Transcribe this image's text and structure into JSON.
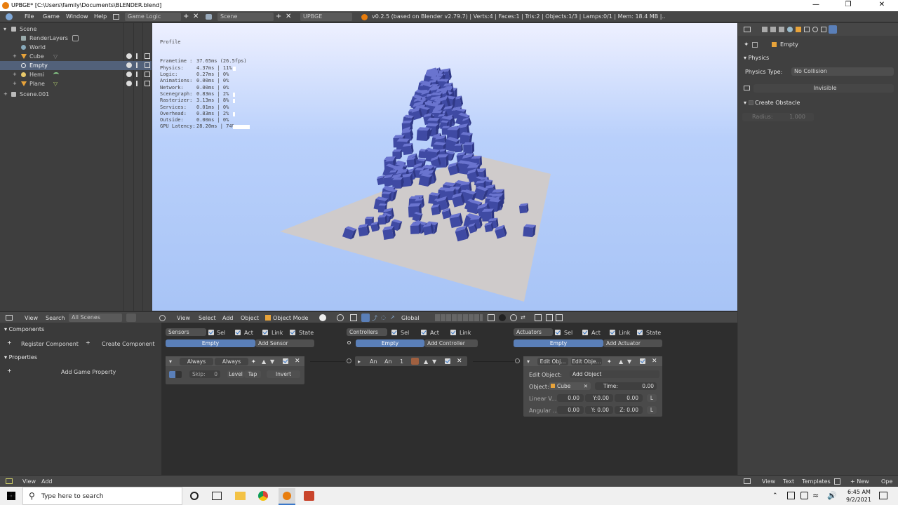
{
  "window": {
    "title": "UPBGE* [C:\\Users\\family\\Documents\\BLENDER.blend]"
  },
  "header": {
    "menus": [
      "File",
      "Game",
      "Window",
      "Help"
    ],
    "screen_layout": "Game Logic",
    "scene_name": "Scene",
    "engine": "UPBGE",
    "info": "v0.2.5 (based on Blender v2.79.7) | Verts:4 | Faces:1 | Tris:2 | Objects:1/3 | Lamps:0/1 | Mem: 18.4 MB |.."
  },
  "outliner": {
    "items": [
      {
        "label": "Scene",
        "icon": "scene-icon"
      },
      {
        "label": "RenderLayers",
        "icon": "renderlayers-icon"
      },
      {
        "label": "World",
        "icon": "world-icon"
      },
      {
        "label": "Cube",
        "icon": "mesh-icon"
      },
      {
        "label": "Empty",
        "icon": "empty-icon"
      },
      {
        "label": "Hemi",
        "icon": "lamp-icon"
      },
      {
        "label": "Plane",
        "icon": "mesh-icon"
      },
      {
        "label": "Scene.001",
        "icon": "scene-icon"
      }
    ]
  },
  "profile": {
    "title": "Profile",
    "rows": [
      {
        "name": "Frametime :",
        "value": "37.65ms (26.5fps)",
        "fill": 0
      },
      {
        "name": "Physics:",
        "value": "4.37ms | 11%",
        "fill": 0.11
      },
      {
        "name": "Logic:",
        "value": "0.27ms | 0%",
        "fill": 0
      },
      {
        "name": "Animations:",
        "value": "0.00ms | 0%",
        "fill": 0
      },
      {
        "name": "Network:",
        "value": "0.00ms | 0%",
        "fill": 0
      },
      {
        "name": "Scenegraph:",
        "value": "0.83ms | 2%",
        "fill": 0.02
      },
      {
        "name": "Rasterizer:",
        "value": "3.13ms | 8%",
        "fill": 0.08
      },
      {
        "name": "Services:",
        "value": "0.01ms | 0%",
        "fill": 0
      },
      {
        "name": "Overhead:",
        "value": "0.83ms | 2%",
        "fill": 0.02
      },
      {
        "name": "Outside:",
        "value": "0.00ms | 0%",
        "fill": 0
      },
      {
        "name": "GPU Latency:",
        "value": "28.20ms | 74%",
        "fill": 0.74
      }
    ]
  },
  "properties": {
    "object_name": "Empty",
    "physics_title": "Physics",
    "physics_type_label": "Physics Type:",
    "physics_type_value": "No Collision",
    "invisible_label": "Invisible",
    "create_obstacle_label": "Create Obstacle",
    "radius_label": "Radius:",
    "radius_value": "1.000"
  },
  "viewport_header": {
    "menus": [
      "View",
      "Select",
      "Add",
      "Object"
    ],
    "mode": "Object Mode",
    "orientation": "Global"
  },
  "outliner_header": {
    "menus": [
      "View",
      "Search"
    ],
    "filter": "All Scenes"
  },
  "logic_side": {
    "components_title": "Components",
    "register_component": "Register Component",
    "create_component": "Create Component",
    "properties_title": "Properties",
    "add_game_property": "Add Game Property"
  },
  "logic": {
    "sensors": {
      "label": "Sensors",
      "filters": [
        "Sel",
        "Act",
        "Link",
        "State"
      ],
      "object": "Empty",
      "add": "Add Sensor",
      "brick_type": "Always",
      "brick_name": "Always",
      "skip_label": "Skip:",
      "skip_value": "0",
      "level": "Level",
      "tap": "Tap",
      "invert": "Invert"
    },
    "controllers": {
      "label": "Controllers",
      "filters": [
        "Sel",
        "Act",
        "Link"
      ],
      "object": "Empty",
      "add": "Add Controller",
      "brick_type": "An",
      "brick_name": "An",
      "brick_num": "1"
    },
    "actuators": {
      "label": "Actuators",
      "filters": [
        "Sel",
        "Act",
        "Link",
        "State"
      ],
      "object": "Empty",
      "add": "Add Actuator",
      "brick_type": "Edit Obj...",
      "brick_name": "Edit Obje...",
      "edit_object_label": "Edit Object:",
      "edit_object_value": "Add Object",
      "object_label": "Object:",
      "object_value": "Cube",
      "time_label": "Time:",
      "time_value": "0.00",
      "linear_label": "Linear V...",
      "angular_label": "Angular ...",
      "linear": [
        "0.00",
        "Y:0.00",
        "0.00"
      ],
      "angular": [
        "0.00",
        "Y: 0.00",
        "Z: 0.00"
      ],
      "local": "L"
    }
  },
  "status_bar": {
    "left_menus": [
      "View",
      "Add"
    ],
    "right_menus": [
      "View",
      "Text",
      "Templates"
    ],
    "new": "New",
    "open": "Ope"
  },
  "taskbar": {
    "search_placeholder": "Type here to search",
    "time": "6:45 AM",
    "date": "9/2/2021"
  },
  "colors": {
    "blender_bg": "#393939",
    "selection_blue": "#5a7fb8",
    "cube_blue": "#4a55b0",
    "plane": "#cfcbcb"
  }
}
